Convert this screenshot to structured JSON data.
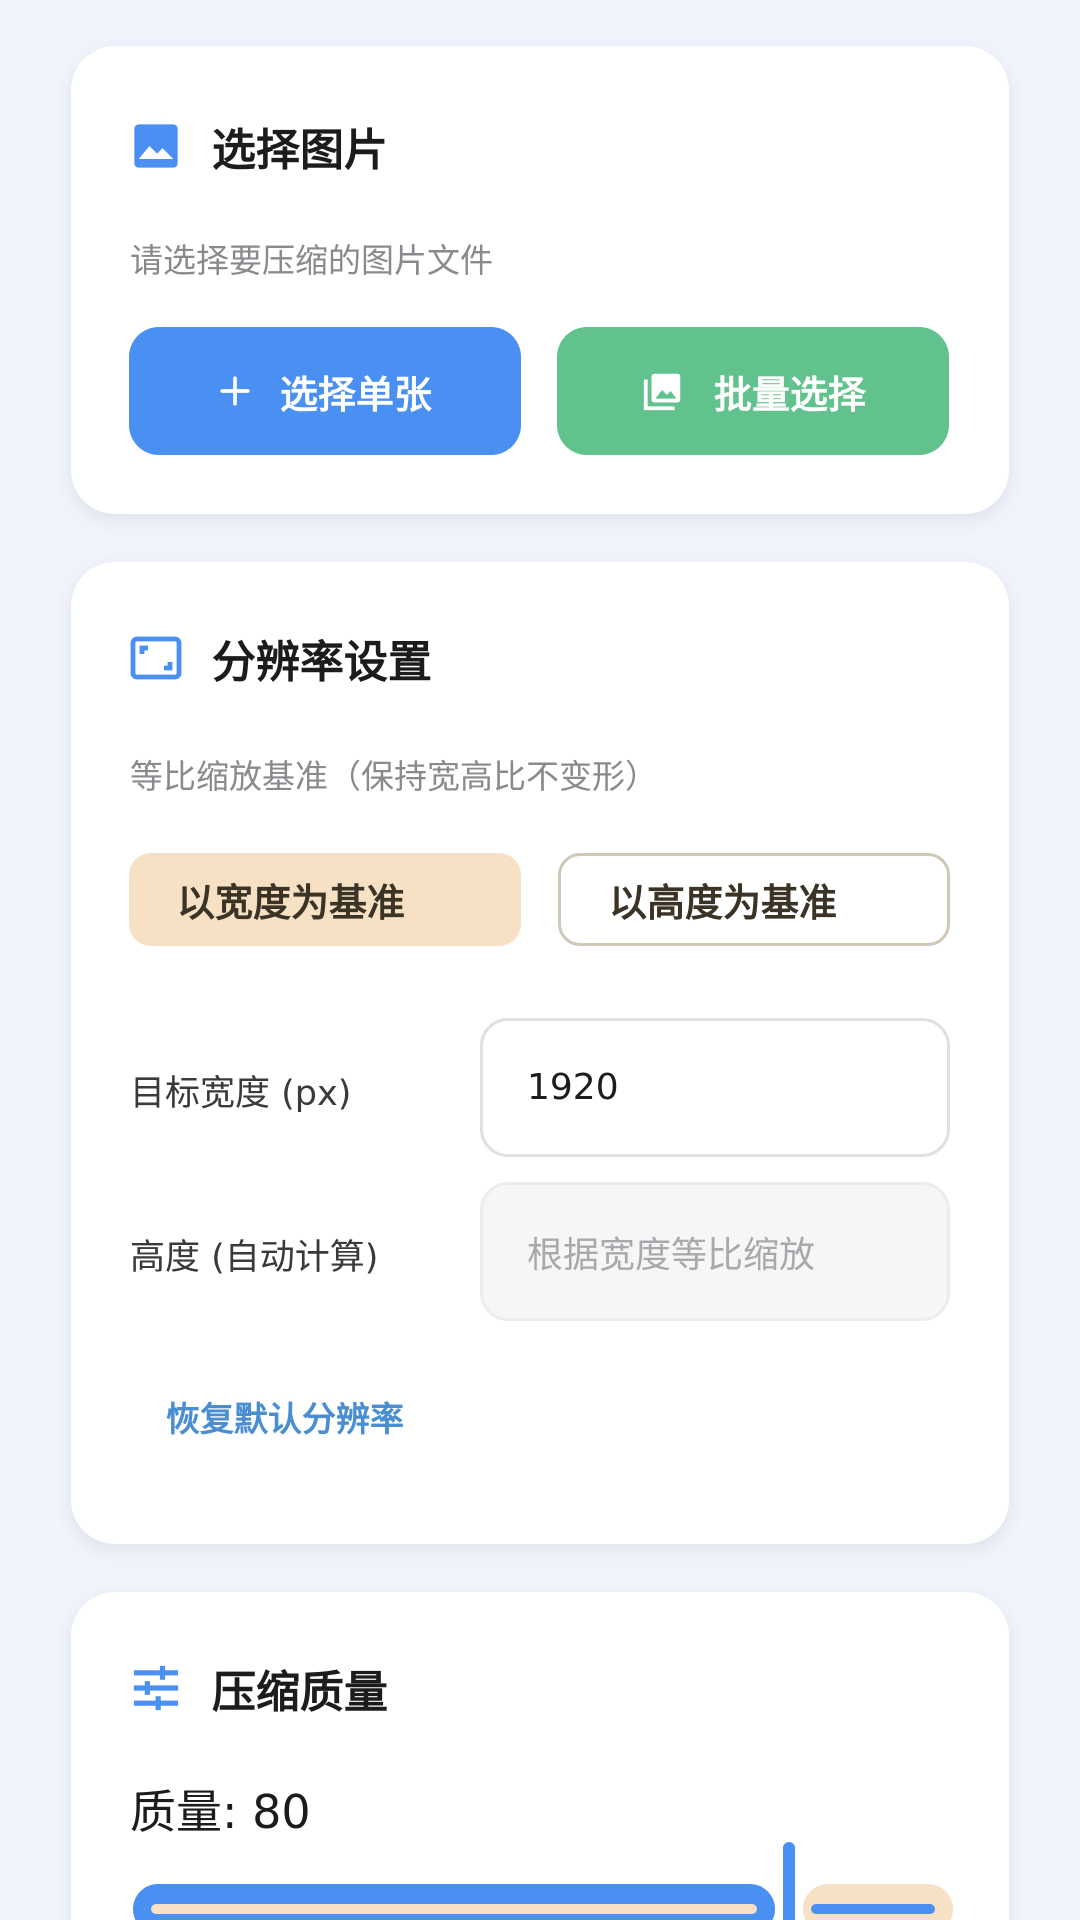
{
  "select_card": {
    "title": "选择图片",
    "icon": "image-icon",
    "subtitle": "请选择要压缩的图片文件",
    "single_button": {
      "label": "选择单张",
      "icon": "plus-icon",
      "color": "#4a8ff2"
    },
    "batch_button": {
      "label": "批量选择",
      "icon": "photo-library-icon",
      "color": "#62c28d"
    }
  },
  "resolution_card": {
    "title": "分辨率设置",
    "icon": "aspect-ratio-icon",
    "subtitle": "等比缩放基准（保持宽高比不变形）",
    "options": [
      {
        "label": "以宽度为基准",
        "selected": true
      },
      {
        "label": "以高度为基准",
        "selected": false
      }
    ],
    "width_label": "目标宽度 (px)",
    "width_value": "1920",
    "height_label": "高度 (自动计算)",
    "height_placeholder": "根据宽度等比缩放",
    "reset_link": "恢复默认分辨率"
  },
  "quality_card": {
    "title": "压缩质量",
    "icon": "tune-icon",
    "quality_label": "质量: 80",
    "quality_value": 80,
    "quality_min": 0,
    "quality_max": 100
  },
  "colors": {
    "accent_blue": "#4a8ff2",
    "accent_green": "#62c28d",
    "selected_chip": "#f6e1c4",
    "link_blue": "#4a8ed2"
  }
}
